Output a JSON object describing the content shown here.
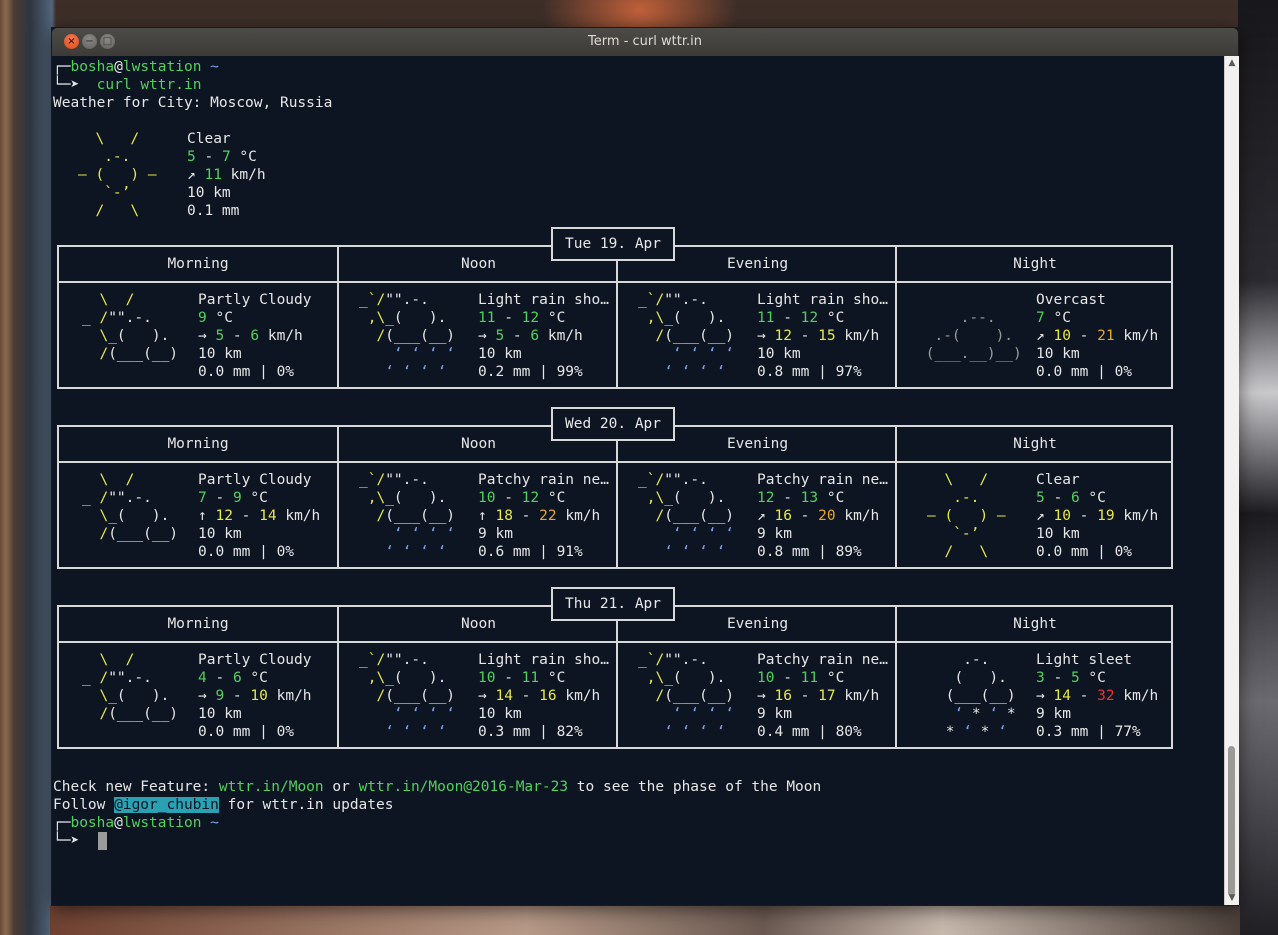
{
  "window": {
    "title": "Term - curl wttr.in"
  },
  "prompt": {
    "user": "bosha",
    "at": "@",
    "host": "lwstation",
    "dir": "~",
    "command": "curl wttr.in"
  },
  "current": {
    "location_line": "Weather for City: Moscow, Russia",
    "condition": "Clear",
    "temp_lo": "5",
    "temp_hi": "7",
    "temp_unit": "°C",
    "wind_arrow": "↗",
    "wind": "11",
    "wind_unit": "km/h",
    "visibility": "10 km",
    "precip": "0.1 mm",
    "icon": "sun-icon"
  },
  "columns": [
    "Morning",
    "Noon",
    "Evening",
    "Night"
  ],
  "days": [
    {
      "date": "Tue 19. Apr",
      "slots": [
        {
          "icon": "partly-cloudy-icon",
          "cond": "Partly Cloudy",
          "t1": "9",
          "t2": "",
          "arrow": "→",
          "w1": "5",
          "w2": "6",
          "vis": "10 km",
          "rain": "0.0 mm | 0%"
        },
        {
          "icon": "rain-shower-icon",
          "cond": "Light rain sho…",
          "t1": "11",
          "t2": "12",
          "arrow": "→",
          "w1": "5",
          "w2": "6",
          "vis": "10 km",
          "rain": "0.2 mm | 99%"
        },
        {
          "icon": "rain-shower-icon",
          "cond": "Light rain sho…",
          "t1": "11",
          "t2": "12",
          "arrow": "→",
          "w1": "12",
          "w2": "15",
          "vis": "10 km",
          "rain": "0.8 mm | 97%"
        },
        {
          "icon": "overcast-icon",
          "cond": "Overcast",
          "t1": "7",
          "t2": "",
          "arrow": "↗",
          "w1": "10",
          "w2": "21",
          "vis": "10 km",
          "rain": "0.0 mm | 0%"
        }
      ]
    },
    {
      "date": "Wed 20. Apr",
      "slots": [
        {
          "icon": "partly-cloudy-icon",
          "cond": "Partly Cloudy",
          "t1": "7",
          "t2": "9",
          "arrow": "↑",
          "w1": "12",
          "w2": "14",
          "vis": "10 km",
          "rain": "0.0 mm | 0%"
        },
        {
          "icon": "rain-shower-icon",
          "cond": "Patchy rain ne…",
          "t1": "10",
          "t2": "12",
          "arrow": "↑",
          "w1": "18",
          "w2": "22",
          "vis": "9 km",
          "rain": "0.6 mm | 91%"
        },
        {
          "icon": "rain-shower-icon",
          "cond": "Patchy rain ne…",
          "t1": "12",
          "t2": "13",
          "arrow": "↗",
          "w1": "16",
          "w2": "20",
          "vis": "9 km",
          "rain": "0.8 mm | 89%"
        },
        {
          "icon": "sun-icon",
          "cond": "Clear",
          "t1": "5",
          "t2": "6",
          "arrow": "↗",
          "w1": "10",
          "w2": "19",
          "vis": "10 km",
          "rain": "0.0 mm | 0%"
        }
      ]
    },
    {
      "date": "Thu 21. Apr",
      "slots": [
        {
          "icon": "partly-cloudy-icon",
          "cond": "Partly Cloudy",
          "t1": "4",
          "t2": "6",
          "arrow": "→",
          "w1": "9",
          "w2": "10",
          "vis": "10 km",
          "rain": "0.0 mm | 0%"
        },
        {
          "icon": "rain-shower-icon",
          "cond": "Light rain sho…",
          "t1": "10",
          "t2": "11",
          "arrow": "→",
          "w1": "14",
          "w2": "16",
          "vis": "10 km",
          "rain": "0.3 mm | 82%"
        },
        {
          "icon": "rain-shower-icon",
          "cond": "Patchy rain ne…",
          "t1": "10",
          "t2": "11",
          "arrow": "→",
          "w1": "16",
          "w2": "17",
          "vis": "9 km",
          "rain": "0.4 mm | 80%"
        },
        {
          "icon": "sleet-icon",
          "cond": "Light sleet",
          "t1": "3",
          "t2": "5",
          "arrow": "→",
          "w1": "14",
          "w2": "32",
          "vis": "9 km",
          "rain": "0.3 mm | 77%"
        }
      ]
    }
  ],
  "footer": {
    "feature_prefix": "Check new Feature: ",
    "link1": "wttr.in/Moon",
    "or": " or ",
    "link2": "wttr.in/Moon@2016-Mar-23",
    "feature_suffix": " to see the phase of the Moon",
    "follow_prefix": "Follow ",
    "handle": "@igor_chubin",
    "follow_suffix": " for wttr.in updates"
  },
  "colors": {
    "green": "#4fd15d",
    "yellow": "#e8e845",
    "orange": "#e8a820",
    "red": "#e83232",
    "background": "#0e1522"
  }
}
